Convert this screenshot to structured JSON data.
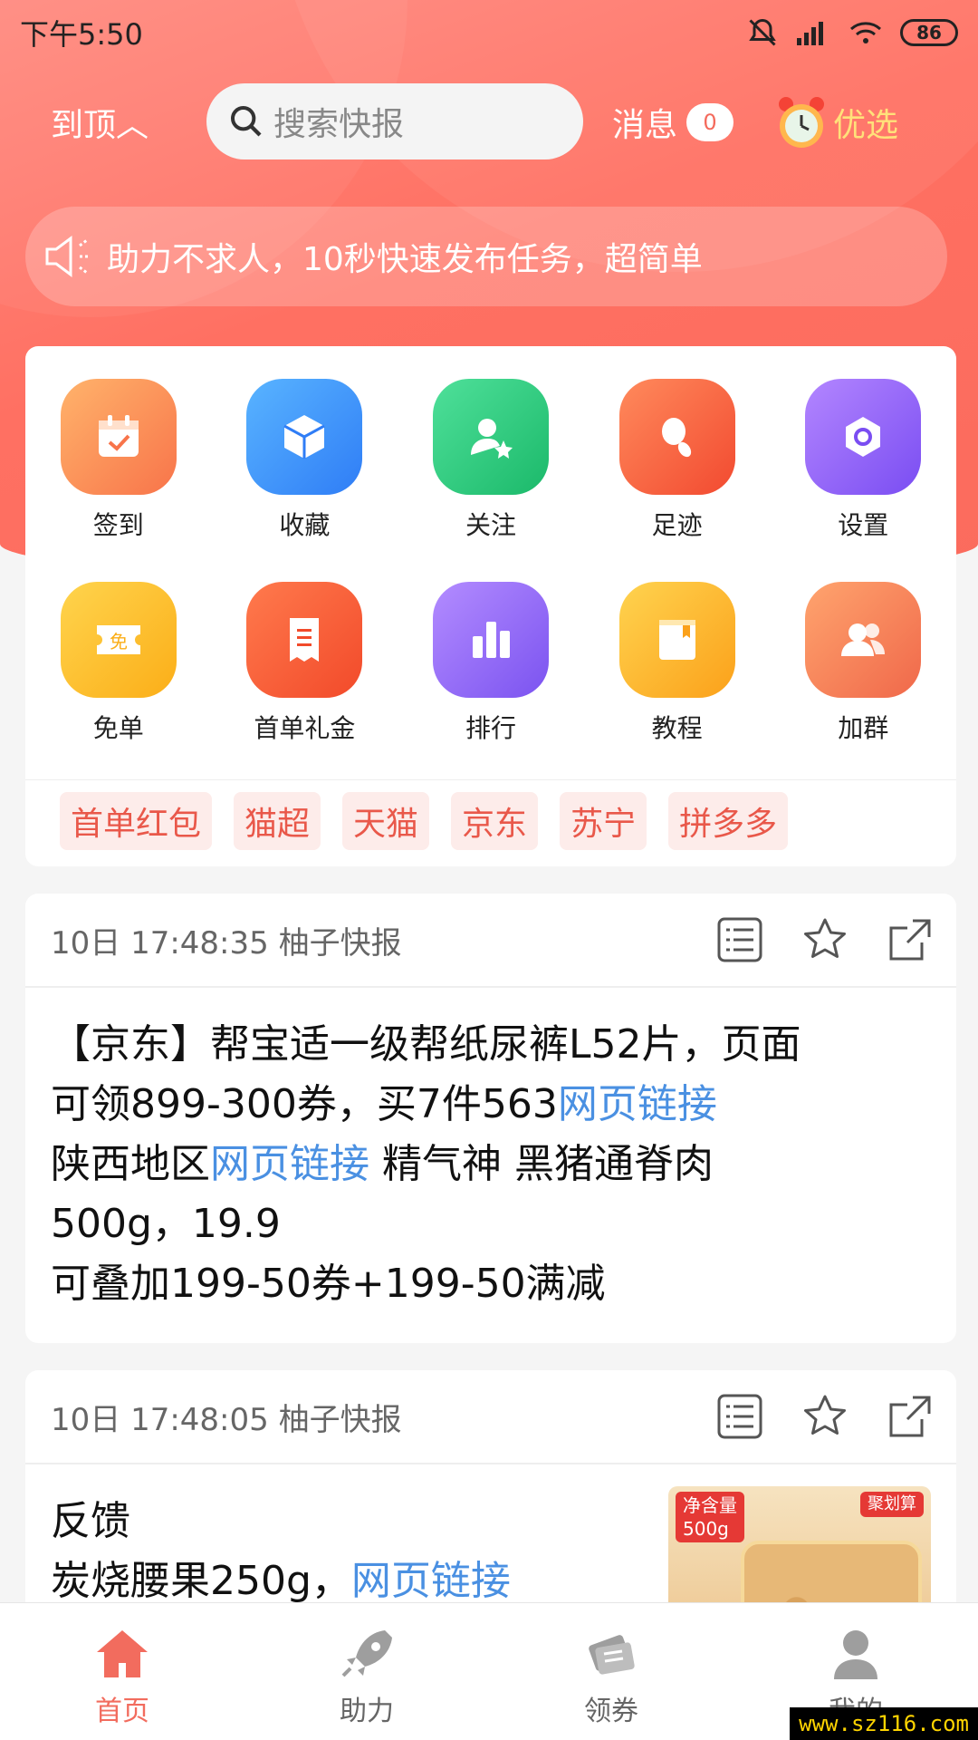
{
  "status_bar": {
    "time": "下午5:50",
    "battery": "86"
  },
  "top_nav": {
    "back_top": "到顶︿",
    "search_placeholder": "搜索快报",
    "messages_label": "消息",
    "messages_count": "0",
    "youxuan_label": "优选"
  },
  "notice": {
    "text": "助力不求人，10秒快速发布任务，超简单"
  },
  "grid": {
    "items": [
      {
        "label": "签到",
        "icon": "calendar-check-icon"
      },
      {
        "label": "收藏",
        "icon": "cube-icon"
      },
      {
        "label": "关注",
        "icon": "user-star-icon"
      },
      {
        "label": "足迹",
        "icon": "footprint-icon"
      },
      {
        "label": "设置",
        "icon": "hexagon-settings-icon"
      },
      {
        "label": "免单",
        "icon": "ticket-free-icon"
      },
      {
        "label": "首单礼金",
        "icon": "receipt-icon"
      },
      {
        "label": "排行",
        "icon": "bar-chart-icon"
      },
      {
        "label": "教程",
        "icon": "book-icon"
      },
      {
        "label": "加群",
        "icon": "group-users-icon"
      }
    ]
  },
  "tags": [
    "首单红包",
    "猫超",
    "天猫",
    "京东",
    "苏宁",
    "拼多多"
  ],
  "feed": [
    {
      "meta": "10日 17:48:35 柚子快报",
      "line1": "【京东】帮宝适一级帮纸尿裤L52片，页面",
      "line2_text": "可领899-300券，买7件563",
      "line2_link": "网页链接",
      "line3_text": "陕西地区",
      "line3_link": "网页链接",
      "line3_after": " 精气神 黑猪通脊肉",
      "line4": "500g，19.9",
      "line5": "可叠加199-50券+199-50满减"
    },
    {
      "meta": "10日 17:48:05 柚子快报",
      "line1": "反馈",
      "line2_text": "炭烧腰果250g，",
      "line2_link": "网页链接",
      "thumb_tag_left": "净含量\n500g",
      "thumb_tag_right": "聚划算"
    }
  ],
  "tabbar": {
    "tabs": [
      {
        "label": "首页",
        "icon": "home-icon",
        "active": true
      },
      {
        "label": "助力",
        "icon": "rocket-icon",
        "active": false
      },
      {
        "label": "领券",
        "icon": "coupon-icon",
        "active": false
      },
      {
        "label": "我的",
        "icon": "user-icon",
        "active": false
      }
    ]
  },
  "watermark": "www.sz116.com",
  "colors": {
    "accent": "#f26c5e",
    "link": "#4a90e2"
  }
}
